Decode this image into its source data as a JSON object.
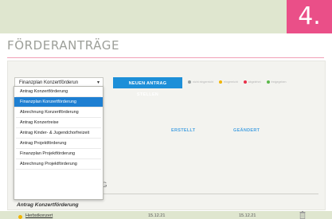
{
  "step_badge": "4.",
  "page": {
    "title": "FÖRDERANTRÄGE"
  },
  "toolbar": {
    "select_value": "Finanzplan Konzertförderun",
    "new_button_label": "NEUEN ANTRAG STELLEN"
  },
  "legend": [
    {
      "label": "nicht eingereicht",
      "color": "#9aa0a0"
    },
    {
      "label": "eingereicht",
      "color": "#f0b400"
    },
    {
      "label": "abgelehnt",
      "color": "#e8304a"
    },
    {
      "label": "freigegeben",
      "color": "#5ab84a"
    }
  ],
  "dropdown": {
    "options": [
      "Antrag Konzertförderung",
      "Finanzplan Konzertförderung",
      "Abrechnung Konzertförderung",
      "Antrag Konzertreise",
      "Antrag Kinder- & Jugendchorfreizeit",
      "Antrag Projektförderung",
      "Finanzplan Projektförderung",
      "Abrechnung Projektförderung"
    ],
    "active_index": 1
  },
  "table": {
    "columns": {
      "created": "ERSTELLT",
      "changed": "GEÄNDERT"
    },
    "section_heading_fragment": "IG",
    "group_title": "Antrag Konzertförderung",
    "rows": [
      {
        "name": "Herbstkonzert",
        "created": "15.12.21",
        "changed": "15.12.21",
        "status_color": "#f0b400"
      }
    ]
  }
}
